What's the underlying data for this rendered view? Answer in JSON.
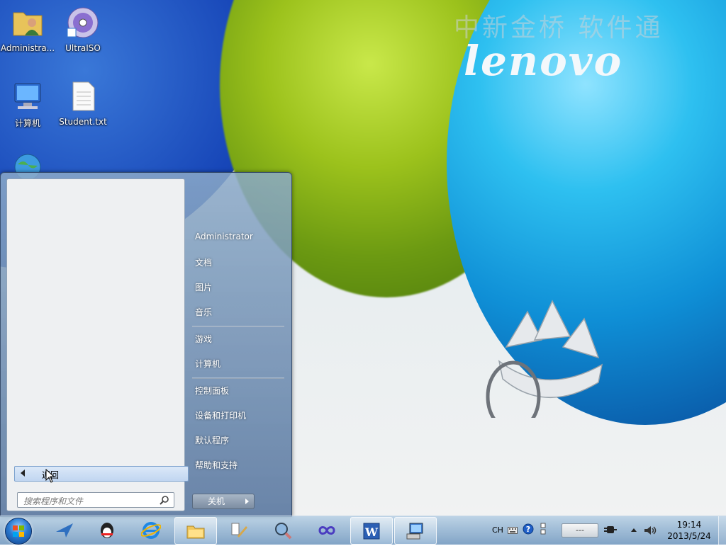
{
  "wallpaper": {
    "watermark": "中新金桥 软件通",
    "brand": "lenovo"
  },
  "desktop_icons": [
    {
      "label": "Administra...",
      "icon": "user-folder-icon"
    },
    {
      "label": "UltraISO",
      "icon": "disc-icon"
    },
    {
      "label": "计算机",
      "icon": "computer-icon"
    },
    {
      "label": "Student.txt",
      "icon": "text-file-icon"
    },
    {
      "label": "",
      "icon": "network-globe-icon"
    }
  ],
  "start_menu": {
    "right_items": [
      "Administrator",
      "文档",
      "图片",
      "音乐",
      "游戏",
      "计算机",
      "控制面板",
      "设备和打印机",
      "默认程序",
      "帮助和支持"
    ],
    "back_label": "返回",
    "search_placeholder": "搜索程序和文件",
    "shutdown_label": "关机"
  },
  "taskbar": {
    "apps": [
      "flight-bird-icon",
      "qq-penguin-icon",
      "internet-explorer-icon",
      "file-explorer-icon",
      "system-tools-icon",
      "magnifier-app-icon",
      "infinity-app-icon",
      "word-icon",
      "remote-desktop-icon"
    ],
    "active_app": "remote-desktop-icon",
    "language": "CH",
    "tray_box_text": "---",
    "time": "19:14",
    "date": "2013/5/24"
  }
}
